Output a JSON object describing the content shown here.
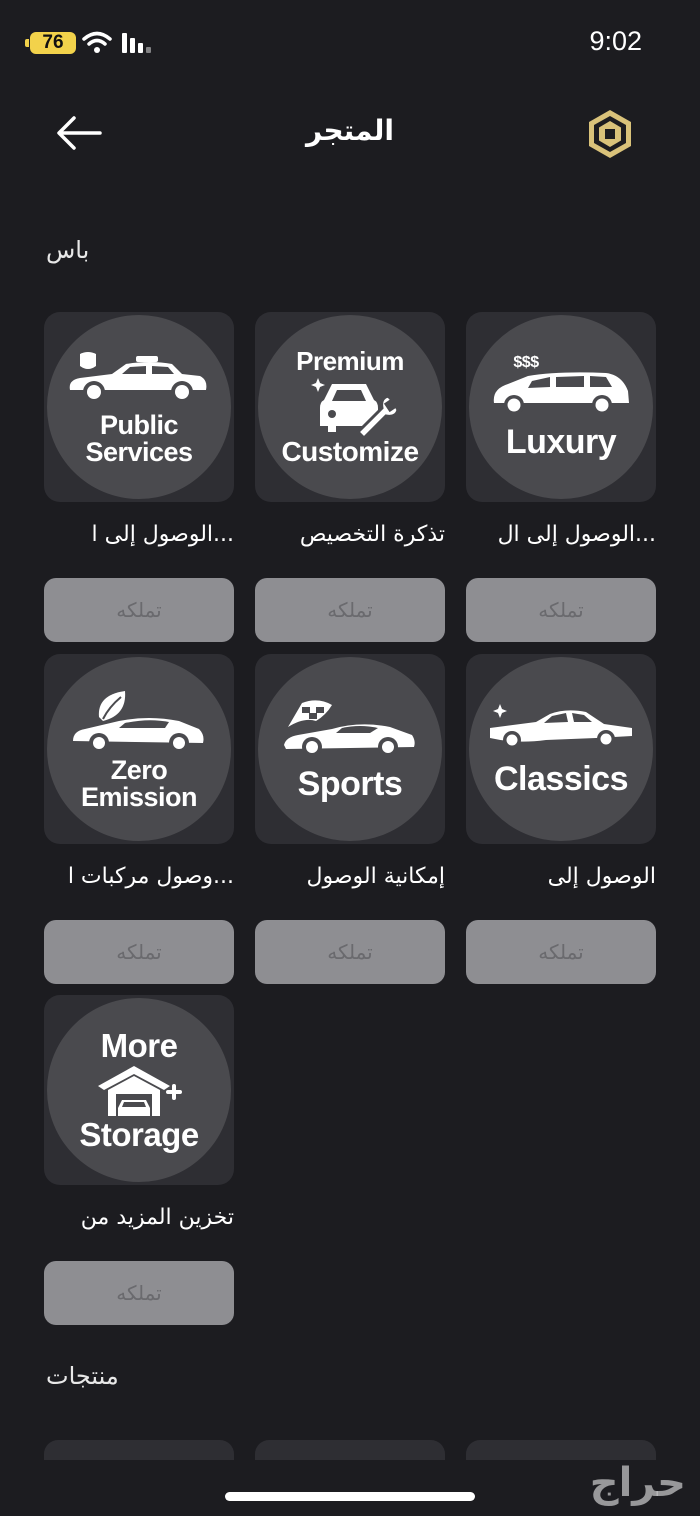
{
  "status_bar": {
    "battery": "76",
    "time": "9:02"
  },
  "header": {
    "title": "المتجر"
  },
  "sections": {
    "passes": "باس",
    "products": "منتجات"
  },
  "items": [
    {
      "badge": [
        "Luxury"
      ],
      "badge_top": "$$$",
      "name": "...الوصول إلى ال",
      "button": "تملكه"
    },
    {
      "badge": [
        "Customize"
      ],
      "badge_top": "Premium",
      "name": "تذكرة التخصيص",
      "button": "تملكه"
    },
    {
      "badge": [
        "Public",
        "Services"
      ],
      "badge_top": "",
      "name": "...الوصول إلى ا",
      "button": "تملكه"
    },
    {
      "badge": [
        "Classics"
      ],
      "badge_top": "",
      "name": "الوصول إلى",
      "button": "تملكه"
    },
    {
      "badge": [
        "Sports"
      ],
      "badge_top": "",
      "name": "إمكانية الوصول",
      "button": "تملكه"
    },
    {
      "badge": [
        "Zero",
        "Emission"
      ],
      "badge_top": "",
      "name": "...وصول مركبات ا",
      "button": "تملكه"
    },
    {
      "badge": [
        "More",
        "Storage"
      ],
      "badge_top": "",
      "name": "تخزين المزيد من",
      "button": "تملكه"
    }
  ],
  "watermark": "حراج",
  "colors": {
    "background": "#1c1c20",
    "tile": "#2e2e33",
    "circle": "#4a4a4e",
    "button": "#8e8e92",
    "battery": "#f2d24b",
    "coin": "#d9c27a"
  }
}
